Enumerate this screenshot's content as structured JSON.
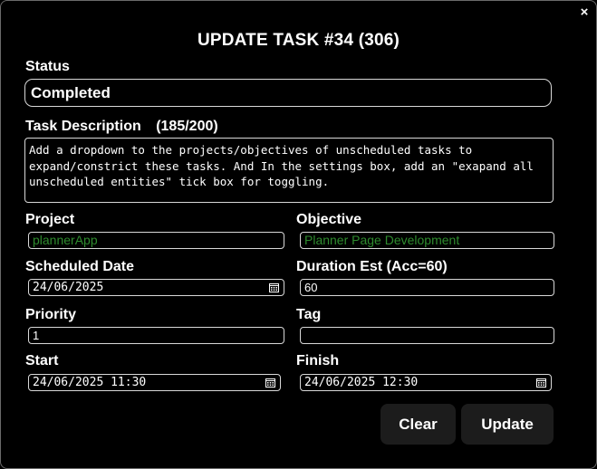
{
  "dialog": {
    "title": "UPDATE TASK #34 (306)",
    "close_label": "×"
  },
  "status": {
    "label": "Status",
    "value": "Completed"
  },
  "description": {
    "label": "Task Description",
    "count": "(185/200)",
    "value": "Add a dropdown to the projects/objectives of unscheduled tasks to expand/constrict these tasks. And In the settings box, add an \"exapand all unscheduled entities\" tick box for toggling."
  },
  "project": {
    "label": "Project",
    "value": "plannerApp"
  },
  "objective": {
    "label": "Objective",
    "value": "Planner Page Development"
  },
  "scheduled_date": {
    "label": "Scheduled Date",
    "value": "24/06/2025"
  },
  "duration": {
    "label": "Duration Est (Acc=60)",
    "value": "60"
  },
  "priority": {
    "label": "Priority",
    "value": "1"
  },
  "tag": {
    "label": "Tag",
    "value": ""
  },
  "start": {
    "label": "Start",
    "value": "24/06/2025 11:30"
  },
  "finish": {
    "label": "Finish",
    "value": "24/06/2025 12:30"
  },
  "actions": {
    "clear_label": "Clear",
    "update_label": "Update"
  },
  "icons": {
    "close": "close-icon",
    "calendar": "calendar-icon"
  },
  "colors": {
    "background": "#000000",
    "border": "#d8d8d8",
    "select_text": "#2e8b2e",
    "button_bg": "#1c1c1c"
  }
}
